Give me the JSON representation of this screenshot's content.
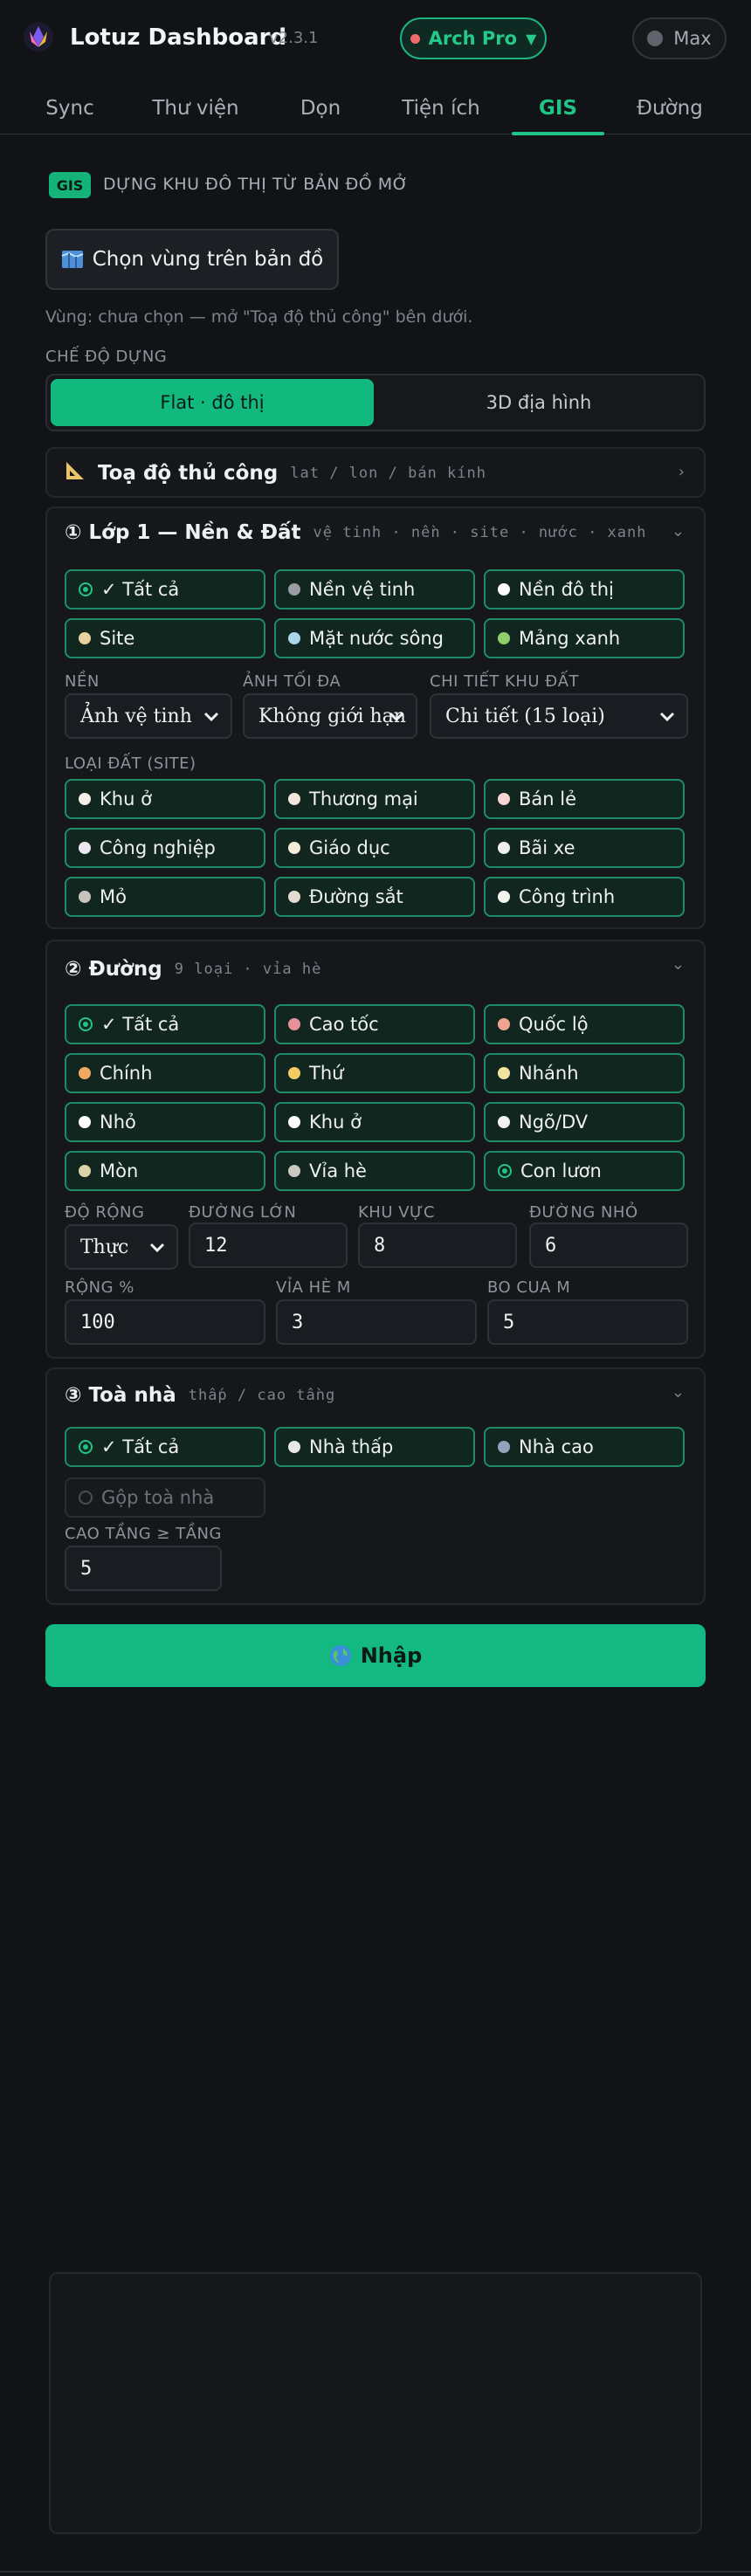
{
  "header": {
    "title": "Lotuz Dashboard",
    "version": "v2.3.1",
    "plan_label": "Arch Pro",
    "max_label": "Max"
  },
  "tabs": [
    {
      "label": "Sync"
    },
    {
      "label": "Thư viện"
    },
    {
      "label": "Dọn"
    },
    {
      "label": "Tiện ích"
    },
    {
      "label": "GIS",
      "active": true
    },
    {
      "label": "Đường"
    }
  ],
  "section": {
    "badge": "GIS",
    "title": "DỰNG KHU ĐÔ THỊ TỪ BẢN ĐỒ MỞ",
    "pick_button": "Chọn vùng trên bản đồ",
    "region_hint": "Vùng: chưa chọn — mở \"Toạ độ thủ công\" bên dưới."
  },
  "mode": {
    "label": "CHẾ ĐỘ DỰNG",
    "options": [
      "Flat · đô thị",
      "3D địa hình"
    ],
    "selected": "Flat · đô thị"
  },
  "manual": {
    "title": "Toạ độ thủ công",
    "subtitle": "lat / lon / bán kính"
  },
  "layer1": {
    "title": "Lớp 1 — Nền & Đất",
    "subtitle": "vệ tinh · nền · site · nước · xanh",
    "chips": [
      {
        "label": "✓ Tất cả",
        "color": "radio"
      },
      {
        "label": "Nền vệ tinh",
        "color": "#9a9ea3"
      },
      {
        "label": "Nền đô thị",
        "color": "#ffffff"
      },
      {
        "label": "Site",
        "color": "#e8d3a0"
      },
      {
        "label": "Mặt nước sông",
        "color": "#a9d6ea"
      },
      {
        "label": "Mảng xanh",
        "color": "#8fcf6a"
      }
    ],
    "base_label": "NỀN",
    "base_value": "Ảnh vệ tinh",
    "max_img_label": "ẢNH TỐI ĐA",
    "max_img_value": "Không giới hạn",
    "detail_label": "CHI TIẾT KHU ĐẤT",
    "detail_value": "Chi tiết (15 loại)",
    "landuse_label": "LOẠI ĐẤT (SITE)",
    "landuse": [
      {
        "label": "Khu ở",
        "color": "#f5f0e6"
      },
      {
        "label": "Thương mại",
        "color": "#f3e6dc"
      },
      {
        "label": "Bán lẻ",
        "color": "#f6d5d2"
      },
      {
        "label": "Công nghiệp",
        "color": "#ece8f2"
      },
      {
        "label": "Giáo dục",
        "color": "#f4ecd8"
      },
      {
        "label": "Bãi xe",
        "color": "#eeeeee"
      },
      {
        "label": "Mỏ",
        "color": "#c9c4bb"
      },
      {
        "label": "Đường sắt",
        "color": "#e4dcd0"
      },
      {
        "label": "Công trình",
        "color": "#f3f3ee"
      }
    ]
  },
  "roads": {
    "title": "Đường",
    "subtitle": "9 loại · vỉa hè",
    "chips": [
      {
        "label": "✓ Tất cả",
        "color": "radio"
      },
      {
        "label": "Cao tốc",
        "color": "#e9919a"
      },
      {
        "label": "Quốc lộ",
        "color": "#f0a38f"
      },
      {
        "label": "Chính",
        "color": "#f2a962"
      },
      {
        "label": "Thứ",
        "color": "#f2cb62"
      },
      {
        "label": "Nhánh",
        "color": "#f1e3a0"
      },
      {
        "label": "Nhỏ",
        "color": "#ffffff"
      },
      {
        "label": "Khu ở",
        "color": "#ffffff"
      },
      {
        "label": "Ngõ/DV",
        "color": "#f3f3f3"
      },
      {
        "label": "Mòn",
        "color": "#dcd2a8"
      },
      {
        "label": "Vỉa hè",
        "color": "#c9c9c2"
      },
      {
        "label": "Con lươn",
        "color": "radio"
      }
    ],
    "width_label": "ĐỘ RỘNG",
    "width_value": "Thực",
    "major_label": "ĐƯỜNG LỚN",
    "major_value": "12",
    "area_label": "KHU VỰC",
    "area_value": "8",
    "minor_label": "ĐƯỜNG NHỎ",
    "minor_value": "6",
    "widthpct_label": "RỘNG %",
    "widthpct_value": "100",
    "sidewalk_label": "VỈA HÈ M",
    "sidewalk_value": "3",
    "corner_label": "BO CUA M",
    "corner_value": "5"
  },
  "buildings": {
    "title": "Toà nhà",
    "subtitle": "thấp / cao tầng",
    "chips": [
      {
        "label": "✓ Tất cả",
        "color": "radio"
      },
      {
        "label": "Nhà thấp",
        "color": "#e9e9e9"
      },
      {
        "label": "Nhà cao",
        "color": "#8fa3bd"
      }
    ],
    "merge_label": "Gộp toà nhà",
    "tall_label": "CAO TẦNG ≥ TẦNG",
    "tall_value": "5"
  },
  "import_button": "Nhập",
  "colors": {
    "accent": "#1ec585",
    "background": "#111317",
    "card": "#15171b"
  }
}
